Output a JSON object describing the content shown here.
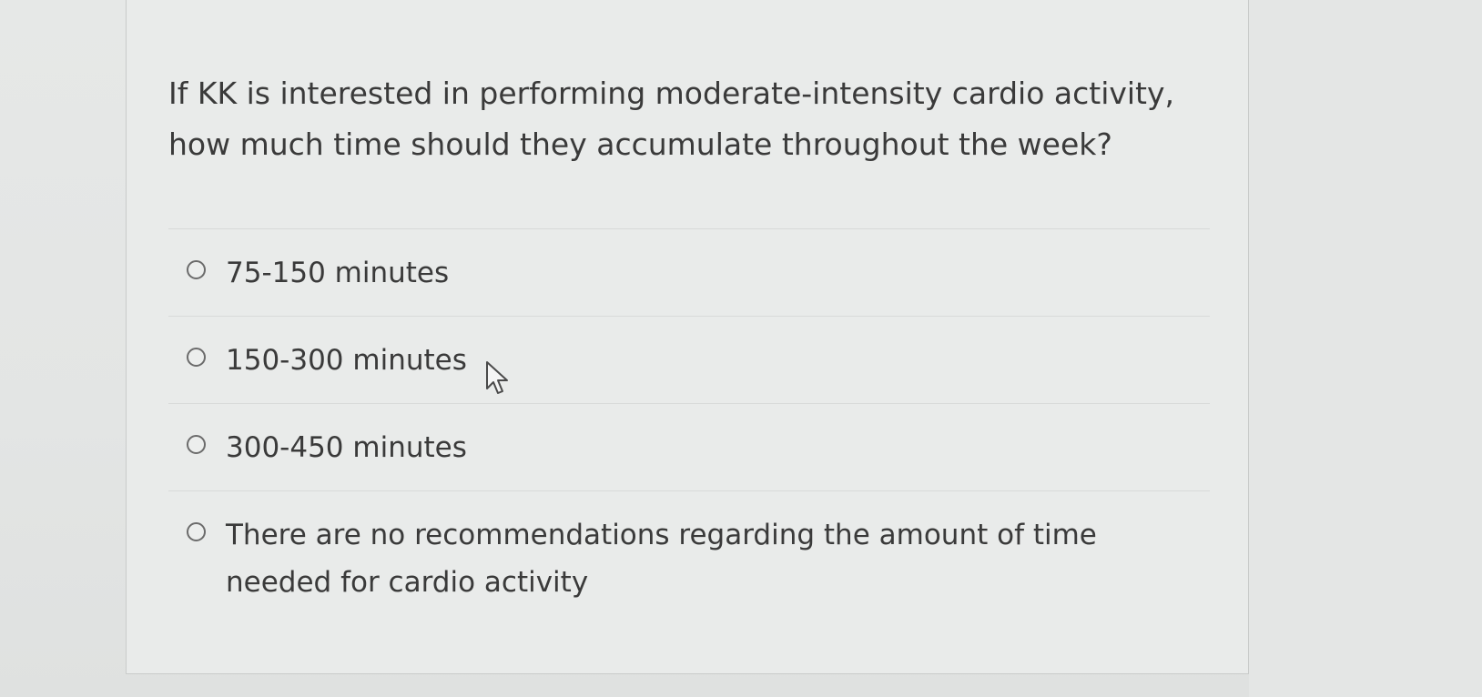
{
  "question": {
    "text": "If KK is interested in performing moderate-intensity cardio activity, how much time should they accumulate throughout the week?"
  },
  "answers": [
    {
      "label": "75-150 minutes",
      "selected": false
    },
    {
      "label": "150-300 minutes",
      "selected": false
    },
    {
      "label": "300-450 minutes",
      "selected": false
    },
    {
      "label": "There are no recommendations regarding the amount of time needed for cardio activity",
      "selected": false
    }
  ],
  "icons": {
    "radio": "radio-button-icon",
    "cursor": "mouse-pointer-icon"
  }
}
